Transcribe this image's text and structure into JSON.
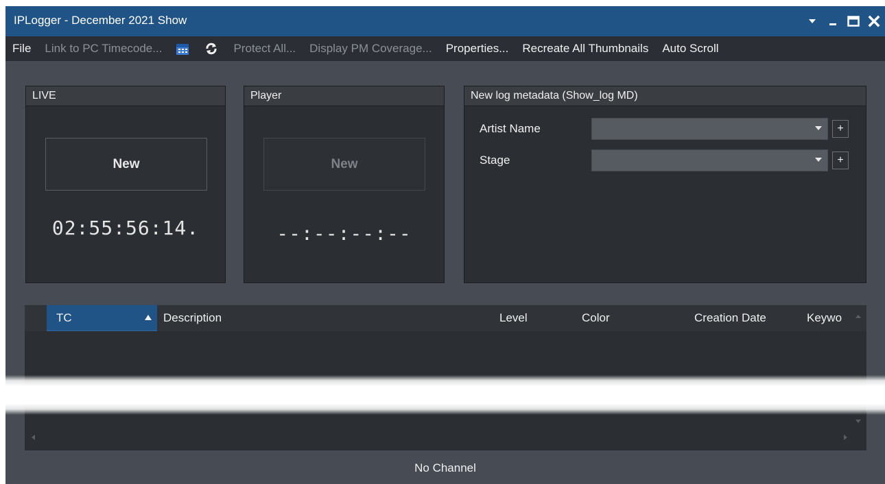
{
  "window": {
    "title": "IPLogger - December 2021 Show",
    "controls": [
      "dropdown-icon",
      "minimize-icon",
      "maximize-icon",
      "close-icon"
    ]
  },
  "menu": {
    "file": "File",
    "link_pc_timecode": "Link to PC Timecode...",
    "calendar_icon": "calendar-icon",
    "refresh_icon": "refresh-icon",
    "protect_all": "Protect All...",
    "display_pm_coverage": "Display PM Coverage...",
    "properties": "Properties...",
    "recreate_thumbnails": "Recreate All Thumbnails",
    "auto_scroll": "Auto Scroll"
  },
  "live": {
    "header": "LIVE",
    "new_label": "New",
    "timecode": "02:55:56:14."
  },
  "player": {
    "header": "Player",
    "new_label": "New",
    "timecode": "--:--:--:--"
  },
  "metadata": {
    "header": "New log metadata (Show_log MD)",
    "fields": [
      {
        "label": "Artist Name",
        "value": "",
        "add": "+"
      },
      {
        "label": "Stage",
        "value": "",
        "add": "+"
      }
    ]
  },
  "grid": {
    "columns": {
      "tc": "TC",
      "description": "Description",
      "level": "Level",
      "color": "Color",
      "creation_date": "Creation Date",
      "keywords": "Keywo"
    },
    "sort_column": "TC",
    "sort_direction": "ascending"
  },
  "status": {
    "channel": "No Channel"
  },
  "colors": {
    "titlebar": "#215486",
    "background": "#464b54",
    "panel": "#2b2e33",
    "selected_column": "#215486"
  }
}
